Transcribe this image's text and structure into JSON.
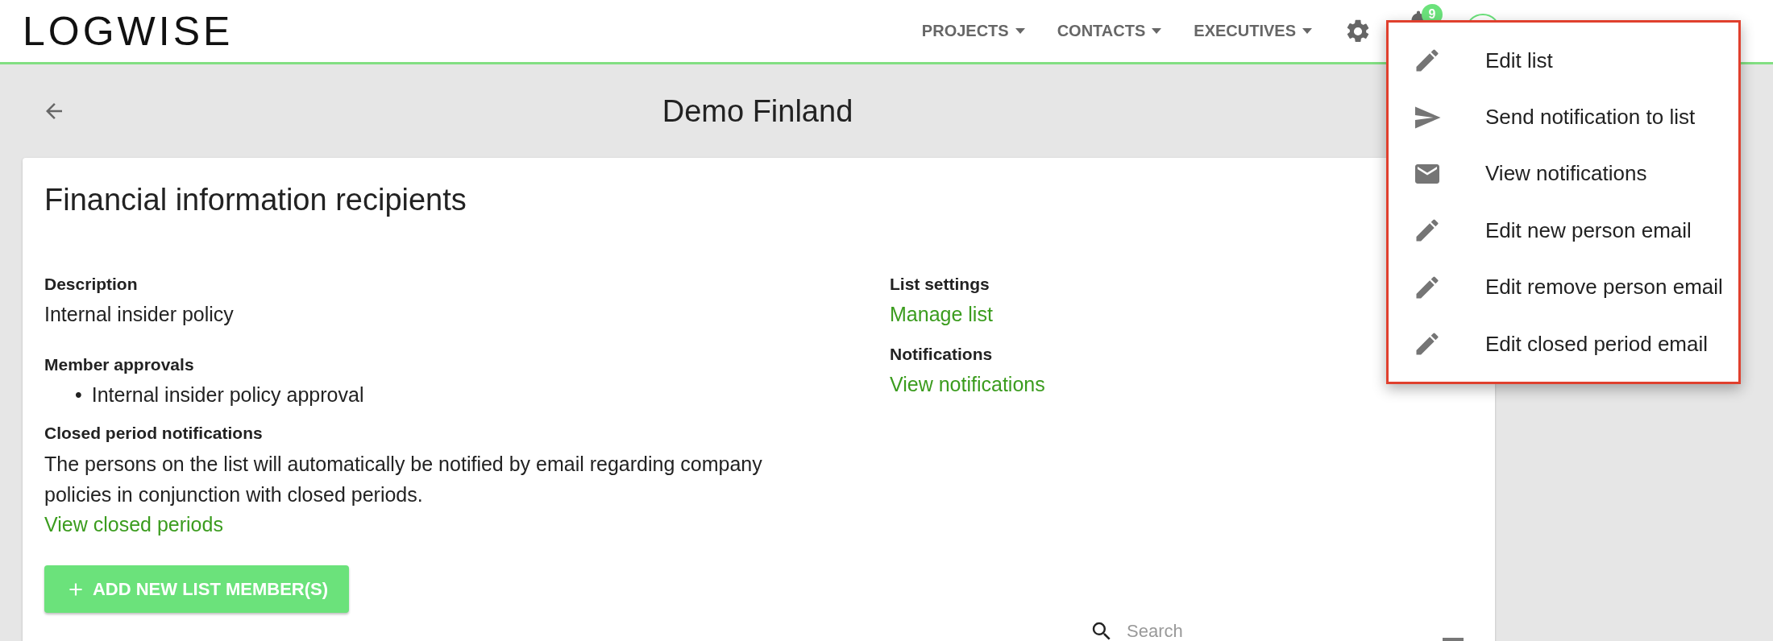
{
  "header": {
    "logo": "LOGWISE",
    "nav": [
      {
        "label": "PROJECTS"
      },
      {
        "label": "CONTACTS"
      },
      {
        "label": "EXECUTIVES"
      }
    ],
    "notification_count": "9"
  },
  "page_title": "Demo Finland",
  "card": {
    "title": "Financial information recipients",
    "left": [
      {
        "kind": "text",
        "label": "Description",
        "value": "Internal insider policy"
      },
      {
        "kind": "bullets",
        "label": "Member approvals",
        "items": [
          {
            "marker": "•",
            "text": "Internal insider policy approval"
          }
        ]
      },
      {
        "kind": "paragraph",
        "label": "Closed period notifications",
        "value": "The persons on the list will automatically be notified by email regarding company policies in conjunction with closed periods.",
        "link": "View closed periods"
      }
    ],
    "right": [
      {
        "kind": "link",
        "label": "List settings",
        "value": "Manage list"
      },
      {
        "kind": "link",
        "label": "Notifications",
        "value": "View notifications"
      }
    ],
    "add_button": "ADD NEW LIST MEMBER(S)",
    "search": {
      "placeholder": "Search"
    }
  },
  "menu": [
    {
      "kind": "edit",
      "label": "Edit list"
    },
    {
      "kind": "send",
      "label": "Send notification to list"
    },
    {
      "kind": "mail",
      "label": "View notifications"
    },
    {
      "kind": "edit",
      "label": "Edit new person email"
    },
    {
      "kind": "edit",
      "label": "Edit remove person email"
    },
    {
      "kind": "edit",
      "label": "Edit closed period email"
    }
  ]
}
